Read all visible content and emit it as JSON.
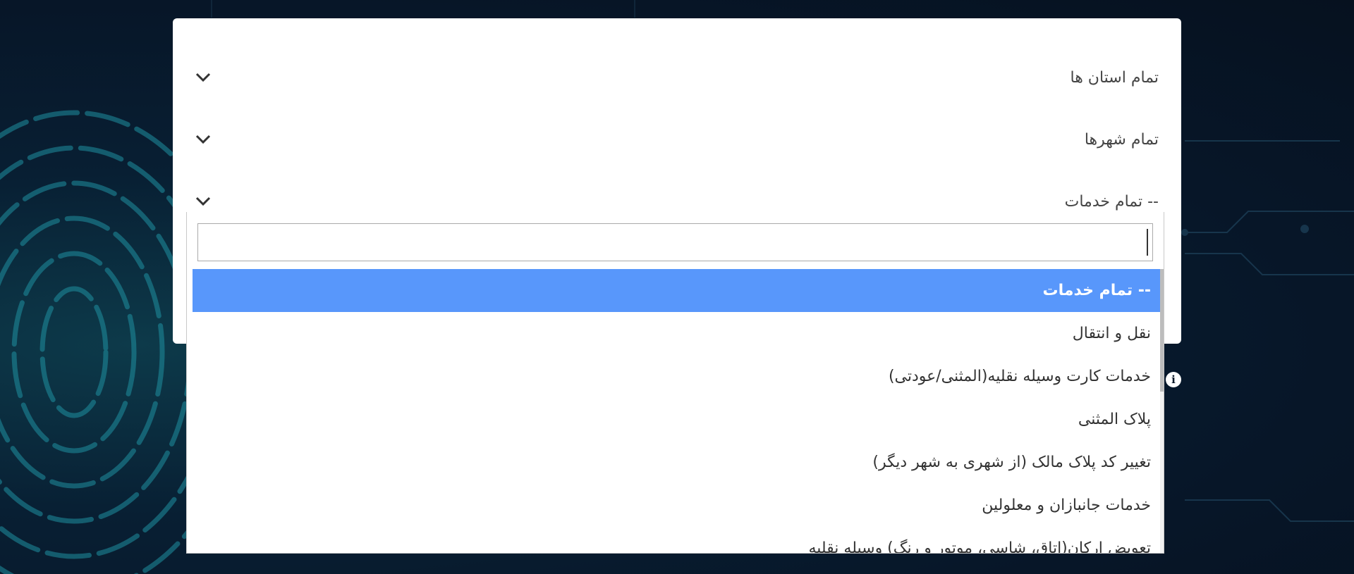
{
  "filters": [
    {
      "label": "تمام استان ها",
      "icon": "chevron-down-icon"
    },
    {
      "label": "تمام شهرها",
      "icon": "chevron-down-icon"
    },
    {
      "label": "-- تمام خدمات",
      "icon": "chevron-down-icon"
    }
  ],
  "dropdown": {
    "search_value": "",
    "options": [
      {
        "label": "-- تمام خدمات",
        "selected": true
      },
      {
        "label": "نقل و انتقال",
        "selected": false
      },
      {
        "label": "خدمات کارت وسیله نقلیه(المثنی/عودتی)",
        "selected": false
      },
      {
        "label": "پلاک المثنی",
        "selected": false
      },
      {
        "label": "تغییر کد پلاک مالک (از شهری به شهر دیگر)",
        "selected": false
      },
      {
        "label": "خدمات جانبازان و معلولین",
        "selected": false
      },
      {
        "label": "تعویض ارکان(اتاق، شاسی، موتور و رنگ) وسیله نقلیه",
        "selected": false
      }
    ]
  },
  "info_icon": {
    "glyph": "i",
    "icon": "info-icon"
  },
  "colors": {
    "selected_bg": "#5897fb",
    "background": "#071628",
    "panel": "#ffffff"
  }
}
